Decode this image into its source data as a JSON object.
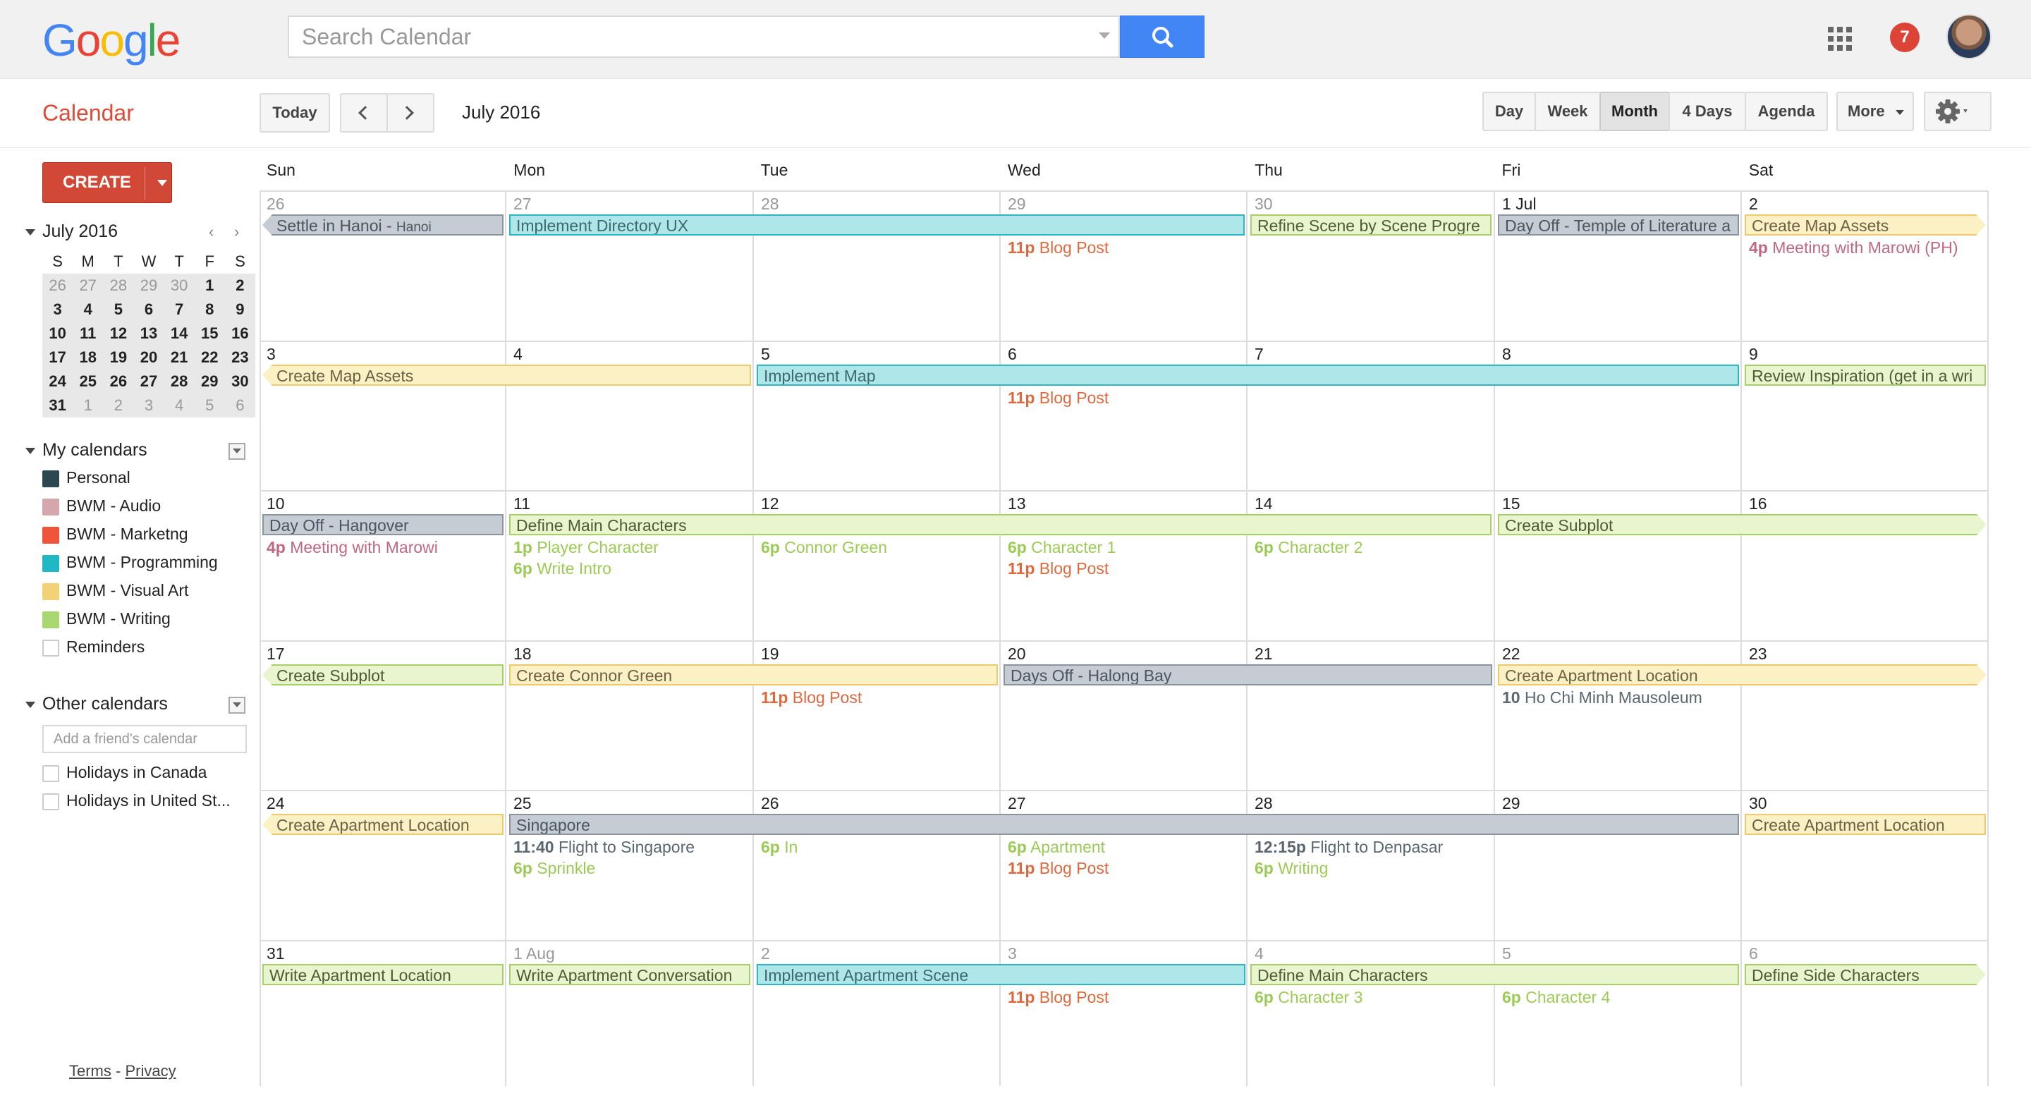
{
  "header": {
    "logo": "Google",
    "search_placeholder": "Search Calendar",
    "notification_count": "7"
  },
  "toolbar": {
    "app_title": "Calendar",
    "today": "Today",
    "current_period": "July 2016",
    "views": [
      "Day",
      "Week",
      "Month",
      "4 Days",
      "Agenda"
    ],
    "selected_view": "Month",
    "more": "More"
  },
  "sidebar": {
    "create": "CREATE",
    "mini_title": "July 2016",
    "mini_dow": [
      "S",
      "M",
      "T",
      "W",
      "T",
      "F",
      "S"
    ],
    "mini_weeks": [
      [
        "26",
        "27",
        "28",
        "29",
        "30",
        "1",
        "2"
      ],
      [
        "3",
        "4",
        "5",
        "6",
        "7",
        "8",
        "9"
      ],
      [
        "10",
        "11",
        "12",
        "13",
        "14",
        "15",
        "16"
      ],
      [
        "17",
        "18",
        "19",
        "20",
        "21",
        "22",
        "23"
      ],
      [
        "24",
        "25",
        "26",
        "27",
        "28",
        "29",
        "30"
      ],
      [
        "31",
        "1",
        "2",
        "3",
        "4",
        "5",
        "6"
      ]
    ],
    "my_calendars_title": "My calendars",
    "my_calendars": [
      {
        "name": "Personal",
        "color": "#2d4750"
      },
      {
        "name": "BWM - Audio",
        "color": "#d5a6ab"
      },
      {
        "name": "BWM - Marketng",
        "color": "#f0553b"
      },
      {
        "name": "BWM - Programming",
        "color": "#20b8c5"
      },
      {
        "name": "BWM - Visual Art",
        "color": "#f3d176"
      },
      {
        "name": "BWM - Writing",
        "color": "#a9d872"
      },
      {
        "name": "Reminders",
        "color": ""
      }
    ],
    "other_calendars_title": "Other calendars",
    "friend_placeholder": "Add a friend's calendar",
    "other_calendars": [
      "Holidays in Canada",
      "Holidays in United St..."
    ],
    "footer_terms": "Terms",
    "footer_sep": " - ",
    "footer_privacy": "Privacy"
  },
  "calendar": {
    "dow": [
      "Sun",
      "Mon",
      "Tue",
      "Wed",
      "Thu",
      "Fri",
      "Sat"
    ],
    "weeks": [
      [
        "26",
        "27",
        "28",
        "29",
        "30",
        "1 Jul",
        "2"
      ],
      [
        "3",
        "4",
        "5",
        "6",
        "7",
        "8",
        "9"
      ],
      [
        "10",
        "11",
        "12",
        "13",
        "14",
        "15",
        "16"
      ],
      [
        "17",
        "18",
        "19",
        "20",
        "21",
        "22",
        "23"
      ],
      [
        "24",
        "25",
        "26",
        "27",
        "28",
        "29",
        "30"
      ],
      [
        "31",
        "1 Aug",
        "2",
        "3",
        "4",
        "5",
        "6"
      ]
    ],
    "banners": [
      {
        "week": 0,
        "start": 0,
        "span": 1,
        "text": "Settle in Hanoi - ",
        "sub": "Hanoi",
        "color": "grey",
        "lcut": true
      },
      {
        "week": 0,
        "start": 1,
        "span": 3,
        "text": "Implement Directory UX",
        "color": "teal"
      },
      {
        "week": 0,
        "start": 4,
        "span": 1,
        "text": "Refine Scene by Scene Progre",
        "color": "green"
      },
      {
        "week": 0,
        "start": 5,
        "span": 1,
        "text": "Day Off - Temple of Literature a",
        "color": "grey"
      },
      {
        "week": 0,
        "start": 6,
        "span": 1,
        "text": "Create Map Assets",
        "color": "yellow",
        "rcut": true
      },
      {
        "week": 1,
        "start": 0,
        "span": 2,
        "text": "Create Map Assets",
        "color": "yellow",
        "lcut": true
      },
      {
        "week": 1,
        "start": 2,
        "span": 4,
        "text": "Implement Map",
        "color": "teal"
      },
      {
        "week": 1,
        "start": 6,
        "span": 1,
        "text": "Review Inspiration (get in a wri",
        "color": "green"
      },
      {
        "week": 2,
        "start": 0,
        "span": 1,
        "text": "Day Off - Hangover",
        "color": "grey"
      },
      {
        "week": 2,
        "start": 1,
        "span": 4,
        "text": "Define Main Characters",
        "color": "green"
      },
      {
        "week": 2,
        "start": 5,
        "span": 2,
        "text": "Create Subplot",
        "color": "green",
        "rcut": true
      },
      {
        "week": 3,
        "start": 0,
        "span": 1,
        "text": "Create Subplot",
        "color": "green",
        "lcut": true
      },
      {
        "week": 3,
        "start": 1,
        "span": 2,
        "text": "Create Connor Green",
        "color": "yellow"
      },
      {
        "week": 3,
        "start": 3,
        "span": 2,
        "text": "Days Off - Halong Bay",
        "color": "grey"
      },
      {
        "week": 3,
        "start": 5,
        "span": 2,
        "text": "Create Apartment Location",
        "color": "yellow",
        "rcut": true
      },
      {
        "week": 4,
        "start": 0,
        "span": 1,
        "text": "Create Apartment Location",
        "color": "yellow",
        "lcut": true
      },
      {
        "week": 4,
        "start": 1,
        "span": 5,
        "text": "Singapore",
        "color": "grey"
      },
      {
        "week": 4,
        "start": 6,
        "span": 1,
        "text": "Create Apartment Location",
        "color": "yellow"
      },
      {
        "week": 5,
        "start": 0,
        "span": 1,
        "text": "Write Apartment Location",
        "color": "green"
      },
      {
        "week": 5,
        "start": 1,
        "span": 1,
        "text": "Write Apartment Conversation",
        "color": "green"
      },
      {
        "week": 5,
        "start": 2,
        "span": 2,
        "text": "Implement Apartment Scene",
        "color": "teal"
      },
      {
        "week": 5,
        "start": 4,
        "span": 2,
        "text": "Define Main Characters",
        "color": "green"
      },
      {
        "week": 5,
        "start": 6,
        "span": 1,
        "text": "Define Side Characters",
        "color": "green",
        "rcut": true
      }
    ],
    "timed": [
      {
        "week": 0,
        "day": 3,
        "line": 0,
        "time": "11p",
        "title": "Blog Post",
        "color": "red"
      },
      {
        "week": 0,
        "day": 6,
        "line": 0,
        "time": "4p",
        "title": "Meeting with Marowi (PH)",
        "color": "pink"
      },
      {
        "week": 1,
        "day": 3,
        "line": 0,
        "time": "11p",
        "title": "Blog Post",
        "color": "red"
      },
      {
        "week": 2,
        "day": 0,
        "line": 0,
        "time": "4p",
        "title": "Meeting with Marowi",
        "color": "pink"
      },
      {
        "week": 2,
        "day": 1,
        "line": 0,
        "time": "1p",
        "title": "Player Character",
        "color": "green"
      },
      {
        "week": 2,
        "day": 1,
        "line": 1,
        "time": "6p",
        "title": "Write Intro",
        "color": "green"
      },
      {
        "week": 2,
        "day": 2,
        "line": 0,
        "time": "6p",
        "title": "Connor Green",
        "color": "green"
      },
      {
        "week": 2,
        "day": 3,
        "line": 0,
        "time": "6p",
        "title": "Character 1",
        "color": "green"
      },
      {
        "week": 2,
        "day": 3,
        "line": 1,
        "time": "11p",
        "title": "Blog Post",
        "color": "red"
      },
      {
        "week": 2,
        "day": 4,
        "line": 0,
        "time": "6p",
        "title": "Character 2",
        "color": "green"
      },
      {
        "week": 3,
        "day": 2,
        "line": 0,
        "time": "11p",
        "title": "Blog Post",
        "color": "red"
      },
      {
        "week": 3,
        "day": 5,
        "line": 0,
        "time": "10",
        "title": "Ho Chi Minh Mausoleum",
        "color": "grey"
      },
      {
        "week": 4,
        "day": 1,
        "line": 0,
        "time": "11:40",
        "title": "Flight to Singapore",
        "color": "grey"
      },
      {
        "week": 4,
        "day": 1,
        "line": 1,
        "time": "6p",
        "title": "Sprinkle",
        "color": "green"
      },
      {
        "week": 4,
        "day": 2,
        "line": 0,
        "time": "6p",
        "title": "In",
        "color": "green"
      },
      {
        "week": 4,
        "day": 3,
        "line": 0,
        "time": "6p",
        "title": "Apartment",
        "color": "green"
      },
      {
        "week": 4,
        "day": 3,
        "line": 1,
        "time": "11p",
        "title": "Blog Post",
        "color": "red"
      },
      {
        "week": 4,
        "day": 4,
        "line": 0,
        "time": "12:15p",
        "title": "Flight to Denpasar",
        "color": "grey"
      },
      {
        "week": 4,
        "day": 4,
        "line": 1,
        "time": "6p",
        "title": "Writing",
        "color": "green"
      },
      {
        "week": 5,
        "day": 3,
        "line": 0,
        "time": "11p",
        "title": "Blog Post",
        "color": "red"
      },
      {
        "week": 5,
        "day": 4,
        "line": 0,
        "time": "6p",
        "title": "Character 3",
        "color": "green"
      },
      {
        "week": 5,
        "day": 5,
        "line": 0,
        "time": "6p",
        "title": "Character 4",
        "color": "green"
      }
    ]
  }
}
